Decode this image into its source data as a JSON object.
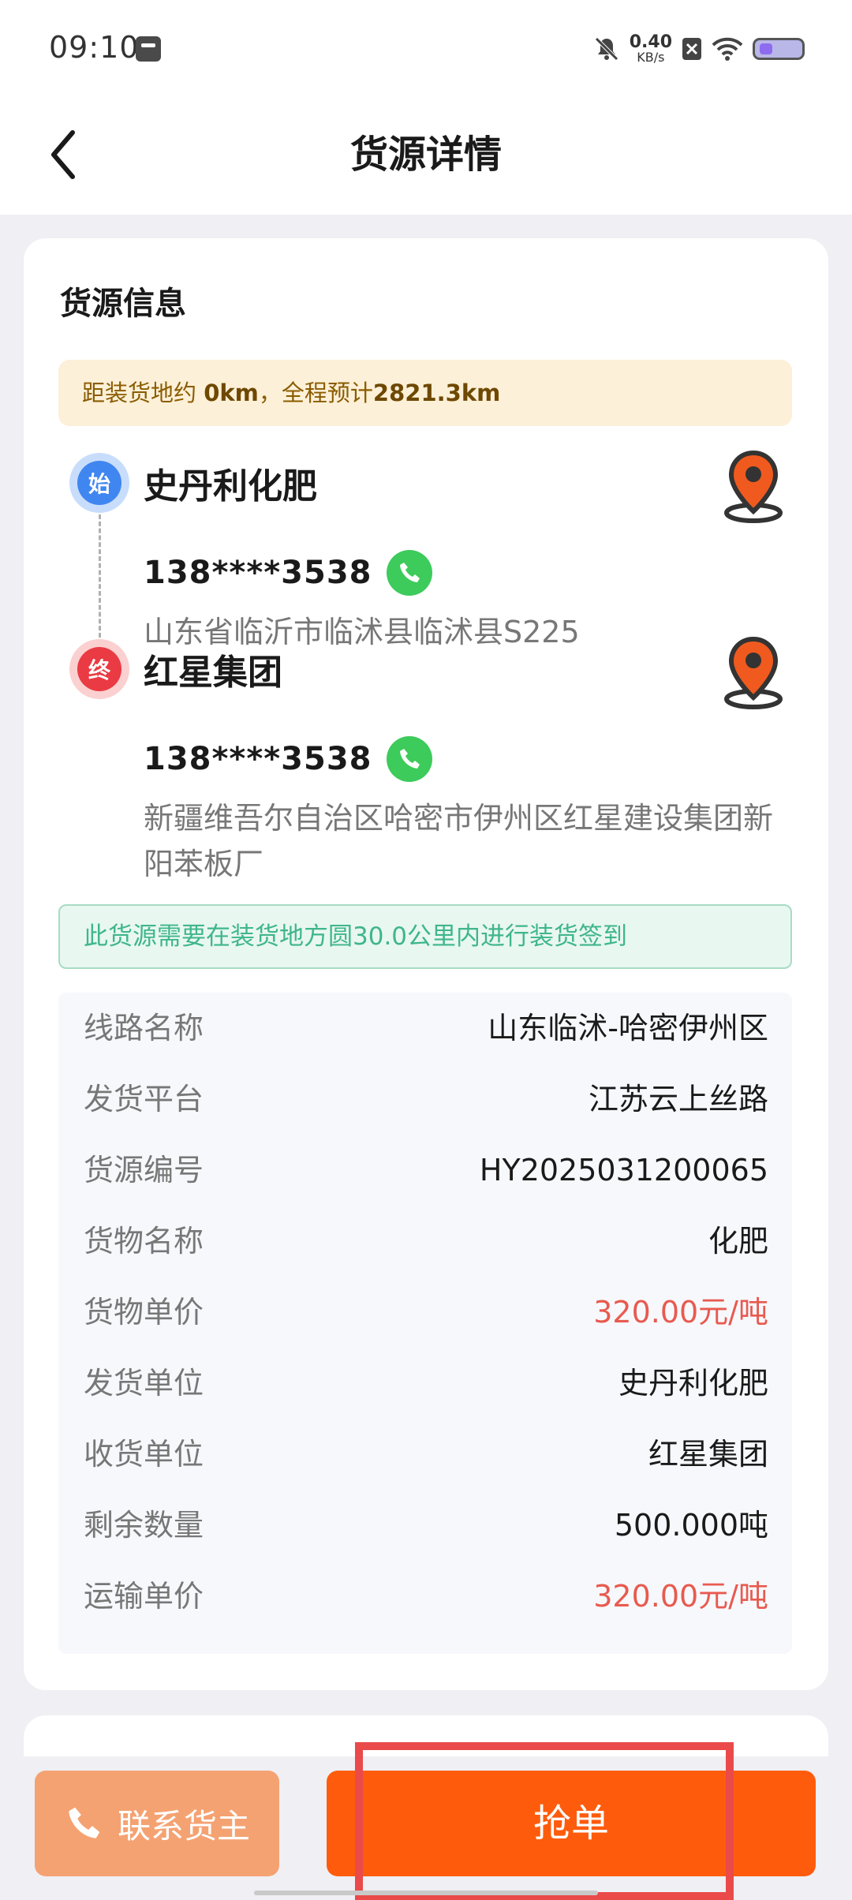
{
  "status_bar": {
    "time": "09:10",
    "net_speed_value": "0.40",
    "net_speed_unit": "KB/s"
  },
  "nav": {
    "title": "货源详情"
  },
  "card": {
    "heading": "货源信息",
    "distance_banner": {
      "prefix": "距装货地约 ",
      "distance": "0km",
      "middle": "，全程预计",
      "total": "2821.3km"
    },
    "route": {
      "start": {
        "badge": "始",
        "name": "史丹利化肥",
        "phone": "138****3538",
        "address": "山东省临沂市临沭县临沭县S225"
      },
      "end": {
        "badge": "终",
        "name": "红星集团",
        "phone": "138****3538",
        "address": "新疆维吾尔自治区哈密市伊州区红星建设集团新阳苯板厂"
      }
    },
    "notice": "此货源需要在装货地方圆30.0公里内进行装货签到",
    "info_rows": [
      {
        "label": "线路名称",
        "value": "山东临沭-哈密伊州区"
      },
      {
        "label": "发货平台",
        "value": "江苏云上丝路"
      },
      {
        "label": "货源编号",
        "value": "HY2025031200065"
      },
      {
        "label": "货物名称",
        "value": "化肥"
      },
      {
        "label": "货物单价",
        "value": "320.00元/吨"
      },
      {
        "label": "发货单位",
        "value": "史丹利化肥"
      },
      {
        "label": "收货单位",
        "value": "红星集团"
      },
      {
        "label": "剩余数量",
        "value": "500.000吨"
      },
      {
        "label": "运输单价",
        "value": "320.00元/吨"
      }
    ]
  },
  "bottom_bar": {
    "contact_label": "联系货主",
    "grab_label": "抢单"
  },
  "colors": {
    "accent": "#fe5c0c",
    "contact_button": "#f5a272",
    "price": "#e85a4f",
    "notice_text": "#3fb68c",
    "start_badge": "#3f86f0",
    "end_badge": "#ea3a43",
    "call_green": "#3dcb5b"
  },
  "icons": {
    "back": "chevron-left-icon",
    "call": "phone-icon",
    "navigate": "map-pin-icon"
  }
}
